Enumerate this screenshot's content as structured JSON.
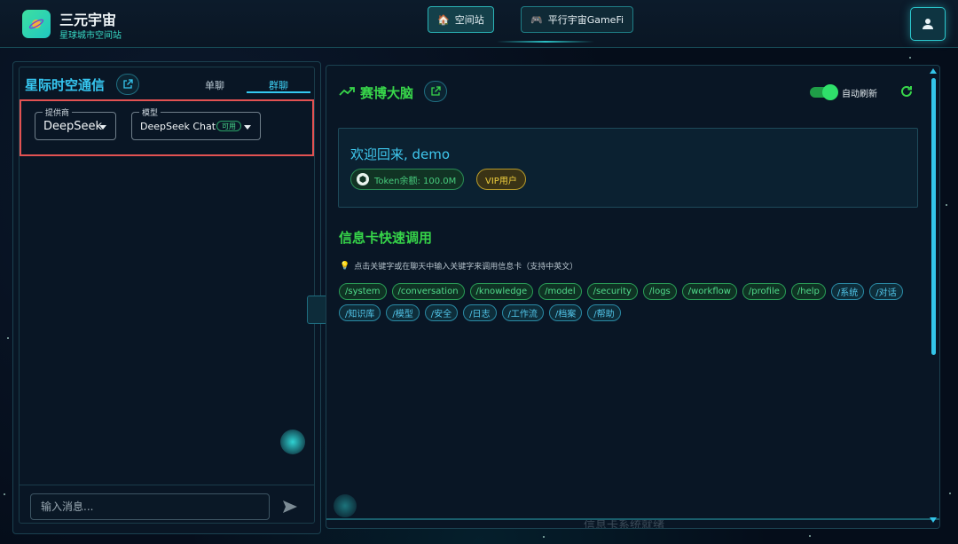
{
  "header": {
    "logo_title": "三元宇宙",
    "logo_subtitle": "星球城市空间站",
    "nav": [
      {
        "label": "空间站",
        "icon": "station-icon",
        "active": true
      },
      {
        "label": "平行宇宙GameFi",
        "icon": "gamepad-icon",
        "active": false
      }
    ],
    "user_icon": "user-icon"
  },
  "chat_panel": {
    "title": "星际时空通信",
    "tabs": [
      {
        "label": "单聊",
        "active": false
      },
      {
        "label": "群聊",
        "active": true
      }
    ],
    "provider": {
      "legend": "提供商",
      "value": "DeepSeek"
    },
    "model": {
      "legend": "模型",
      "value": "DeepSeek Chat",
      "badge": "可用"
    },
    "input_placeholder": "输入消息..."
  },
  "brain_panel": {
    "title": "赛博大脑",
    "auto_refresh_label": "自动刷新",
    "auto_refresh_on": true,
    "welcome_text": "欢迎回来, demo",
    "token_label": "Token余额: 100.0M",
    "vip_label": "VIP用户",
    "section_title": "信息卡快速调用",
    "hint": "点击关键字或在聊天中输入关键字来调用信息卡（支持中英文）",
    "tags": [
      {
        "text": "/system",
        "lang": "en"
      },
      {
        "text": "/conversation",
        "lang": "en"
      },
      {
        "text": "/knowledge",
        "lang": "en"
      },
      {
        "text": "/model",
        "lang": "en"
      },
      {
        "text": "/security",
        "lang": "en"
      },
      {
        "text": "/logs",
        "lang": "en"
      },
      {
        "text": "/workflow",
        "lang": "en"
      },
      {
        "text": "/profile",
        "lang": "en"
      },
      {
        "text": "/help",
        "lang": "en"
      },
      {
        "text": "/系统",
        "lang": "cn"
      },
      {
        "text": "/对话",
        "lang": "cn"
      },
      {
        "text": "/知识库",
        "lang": "cn"
      },
      {
        "text": "/模型",
        "lang": "cn"
      },
      {
        "text": "/安全",
        "lang": "cn"
      },
      {
        "text": "/日志",
        "lang": "cn"
      },
      {
        "text": "/工作流",
        "lang": "cn"
      },
      {
        "text": "/档案",
        "lang": "cn"
      },
      {
        "text": "/帮助",
        "lang": "cn"
      }
    ],
    "footer_faded": "信息卡系统就绪"
  },
  "colors": {
    "accent_cyan": "#36c6f0",
    "accent_green": "#38d64a",
    "highlight_red": "#e25252",
    "vip_gold": "#f0cf3d"
  }
}
